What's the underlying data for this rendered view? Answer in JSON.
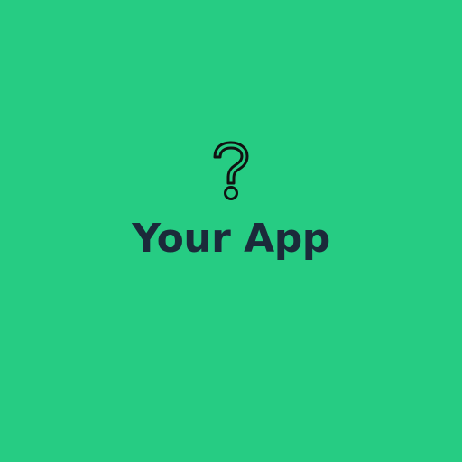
{
  "app": {
    "title": "Your App",
    "icon": "question-mark-icon",
    "background_color": "#26CC83",
    "text_color": "#1B2A3A"
  }
}
